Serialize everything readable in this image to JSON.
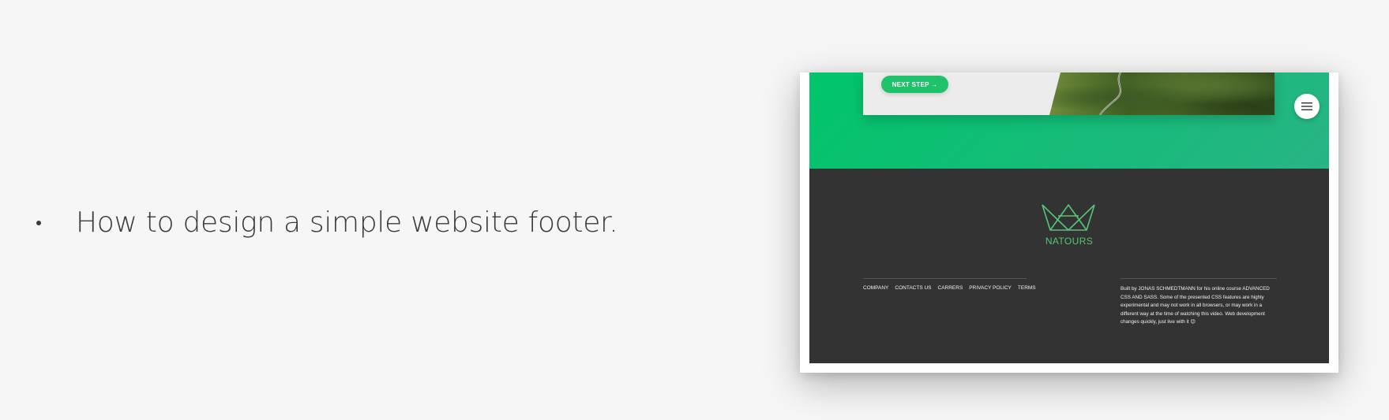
{
  "slide": {
    "bullet_text": "How to design a simple website footer."
  },
  "screenshot": {
    "card": {
      "button_label": "NEXT STEP →"
    },
    "menu_button": {
      "icon": "hamburger-menu-icon"
    },
    "footer": {
      "logo_icon": "crown-logo-icon",
      "brand": "NATOURS",
      "nav": [
        "COMPANY",
        "CONTACTS US",
        "CARRERS",
        "PRIVACY POLICY",
        "TERMS"
      ],
      "copyright": "Built by JONAS SCHMEDTMANN for his online course ADVANCED CSS AND SASS. Some of the presented CSS features are highly experimental and may not work in all browsers, or may work in a different way at the time of watching this video. Web development changes quickly, just live with it 😉"
    },
    "colors": {
      "green_start": "#00c56a",
      "green_end": "#28b485",
      "footer_bg": "#333333",
      "brand_green": "#55c57a"
    }
  }
}
